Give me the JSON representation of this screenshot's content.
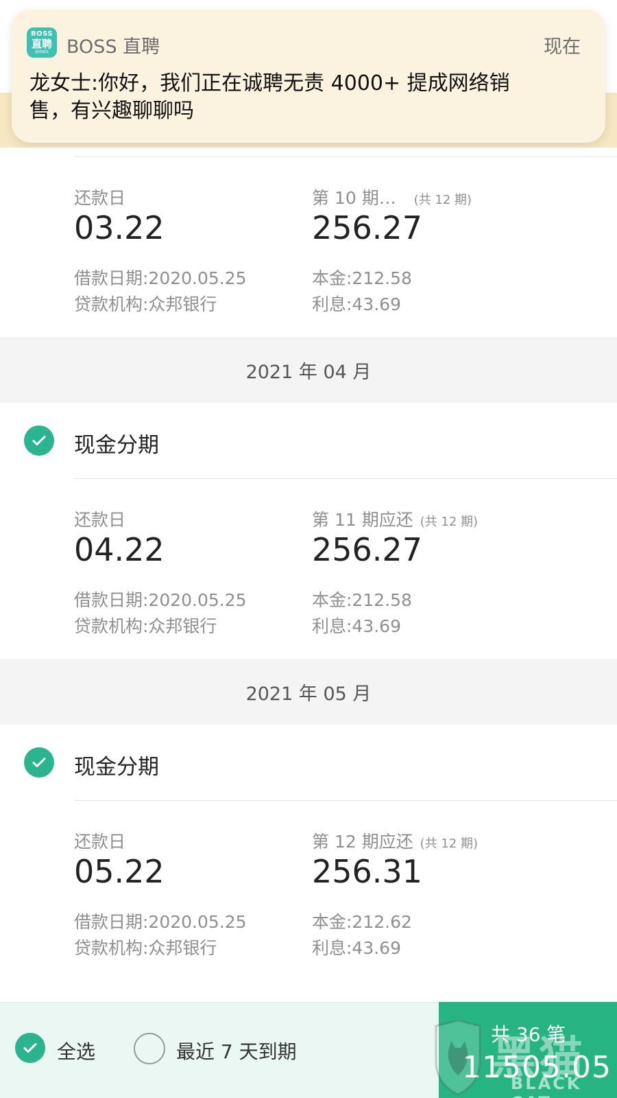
{
  "notification": {
    "app_icon": {
      "line1": "BOSS",
      "line2": "直聘",
      "line3": "提绩面试"
    },
    "app_name": "BOSS 直聘",
    "time": "现在",
    "message": "龙女士:你好，我们正在诚聘无责 4000+ 提成网络销售，有兴趣聊聊吗"
  },
  "labels": {
    "repay_day": "还款日",
    "category": "现金分期"
  },
  "installments": [
    {
      "date": "03.22",
      "period_label": "第 10 期…",
      "total_periods": "(共 12 期)",
      "amount": "256.27",
      "loan_date": "借款日期:2020.05.25",
      "principal": "本金:212.58",
      "institution": "贷款机构:众邦银行",
      "interest": "利息:43.69"
    },
    {
      "date": "04.22",
      "period_label": "第 11 期应还",
      "total_periods": "(共 12 期)",
      "amount": "256.27",
      "loan_date": "借款日期:2020.05.25",
      "principal": "本金:212.58",
      "institution": "贷款机构:众邦银行",
      "interest": "利息:43.69"
    },
    {
      "date": "05.22",
      "period_label": "第 12 期应还",
      "total_periods": "(共 12 期)",
      "amount": "256.31",
      "loan_date": "借款日期:2020.05.25",
      "principal": "本金:212.62",
      "institution": "贷款机构:众邦银行",
      "interest": "利息:43.69"
    }
  ],
  "months": [
    "2021 年 04 月",
    "2021 年 05 月"
  ],
  "bottom_bar": {
    "select_all": "全选",
    "recent_7_days": "最近 7 天到期",
    "pay_count": "共 36 笔",
    "pay_amount": "11505.05"
  },
  "watermark": {
    "text": "黑猫",
    "sub": "BLACK CAT"
  },
  "colors": {
    "accent_green": "#2bb58e",
    "pay_button": "#27b483",
    "notification_bg": "#fbf3df",
    "header_strip": "#f6e6c2"
  }
}
